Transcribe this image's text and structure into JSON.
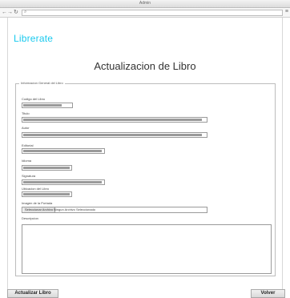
{
  "window": {
    "title": "Admin"
  },
  "browser": {
    "nav": {
      "back": "←",
      "forward": "→",
      "reload": "↻"
    },
    "url_icon": "search-icon",
    "menu_icon": "menu-icon"
  },
  "brand": {
    "text": "Librerate",
    "color": "#19c9ee"
  },
  "page_title": "Actualizacion de Libro",
  "form": {
    "legend": "Informacion General del Libro",
    "fields": [
      {
        "label": "Codigo del Libro",
        "fill_fraction": 0.8
      },
      {
        "label": "Titulo",
        "fill_fraction": 0.98
      },
      {
        "label": "Autor",
        "fill_fraction": 0.98
      },
      {
        "label": "Editorial",
        "fill_fraction": 0.98
      },
      {
        "label": "Idioma",
        "fill_fraction": 0.98
      },
      {
        "label": "Signatura",
        "fill_fraction": 0.98
      },
      {
        "label": "Ubicacion del Libro",
        "fill_fraction": 0.98
      }
    ],
    "image": {
      "label": "Imagen de la Portada",
      "button": "Seleccionar Archivo",
      "status": "Ningun Archivo Seleccionado"
    },
    "description": {
      "label": "Descripcion",
      "value": ""
    }
  },
  "actions": {
    "submit": "Actualizar Libro",
    "back": "Volver"
  }
}
